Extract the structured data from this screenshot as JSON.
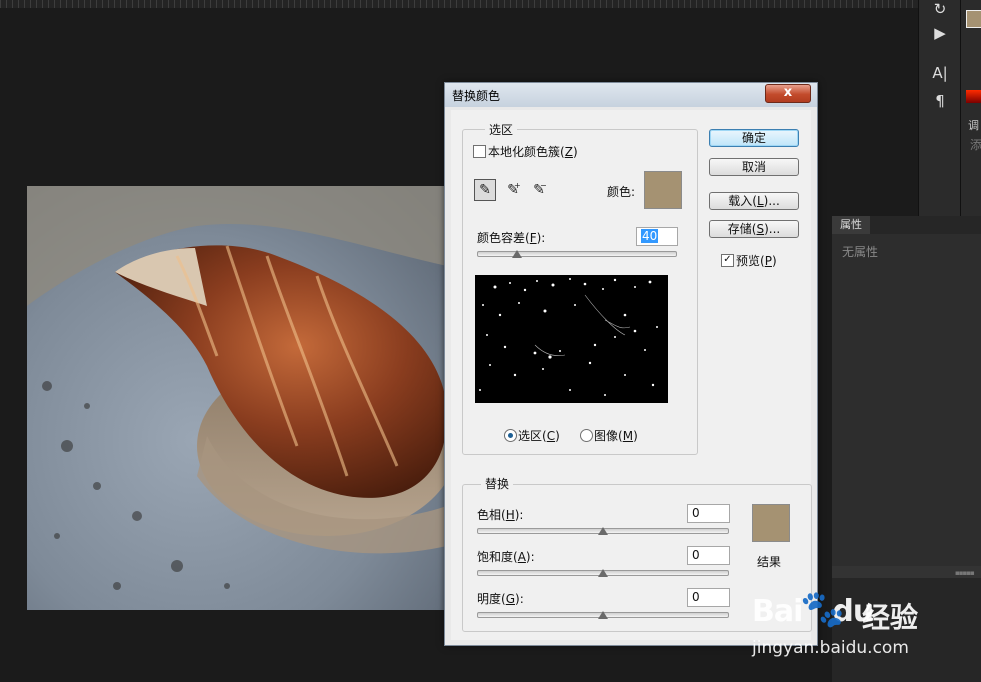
{
  "dialog": {
    "title": "替换颜色",
    "close_glyph": "x",
    "selection": {
      "group_label": "选区",
      "localized_clusters_label": "本地化颜色簇",
      "localized_clusters_key": "Z",
      "localized_clusters_checked": false,
      "color_label": "颜色:",
      "fuzziness_label": "颜色容差",
      "fuzziness_key": "F",
      "fuzziness_value": "40",
      "view_selection_label": "选区",
      "view_selection_key": "C",
      "view_image_label": "图像",
      "view_image_key": "M",
      "selected_view": "selection"
    },
    "buttons": {
      "ok": "确定",
      "cancel": "取消",
      "load": "载入",
      "load_key": "L",
      "save": "存储",
      "save_key": "S",
      "ellipsis": "...",
      "preview_label": "预览",
      "preview_key": "P",
      "preview_checked": true
    },
    "replacement": {
      "group_label": "替换",
      "hue_label": "色相",
      "hue_key": "H",
      "hue_value": "0",
      "saturation_label": "饱和度",
      "saturation_key": "A",
      "saturation_value": "0",
      "lightness_label": "明度",
      "lightness_key": "G",
      "lightness_value": "0",
      "result_label": "结果"
    },
    "colors": {
      "sample": "#a59272",
      "result": "#a59272"
    }
  },
  "panels": {
    "properties_tab": "属性",
    "properties_empty": "无属性",
    "adjustments_tab": "调",
    "add_label": "添"
  },
  "watermark": {
    "logo": "Bai",
    "logo_suffix": "du",
    "brand_cn": "经验",
    "url": "jingyan.baidu.com"
  },
  "icons": [
    "rotate-icon",
    "play-icon",
    "character-icon",
    "paragraph-icon",
    "eyedropper-icon",
    "eyedropper-plus-icon",
    "eyedropper-minus-icon",
    "paw-icon"
  ]
}
